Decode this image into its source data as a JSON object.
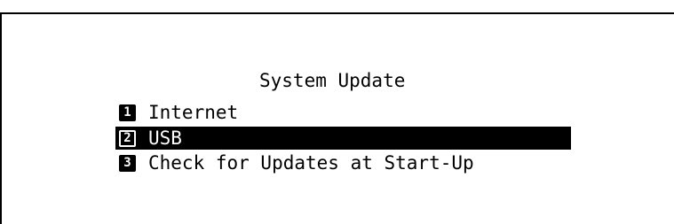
{
  "screen": {
    "title": "System Update"
  },
  "menu": {
    "items": [
      {
        "number": "1",
        "label": "Internet",
        "selected": false
      },
      {
        "number": "2",
        "label": "USB",
        "selected": true
      },
      {
        "number": "3",
        "label": "Check for Updates at Start-Up",
        "selected": false
      }
    ]
  },
  "colors": {
    "background": "#ffffff",
    "text": "#000000",
    "highlight": "#000000",
    "highlight_text": "#ffffff"
  }
}
